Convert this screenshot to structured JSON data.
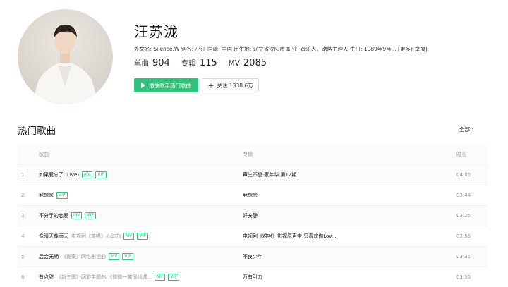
{
  "artist": {
    "name": "汪苏泷",
    "meta": {
      "en_label": "外文名:",
      "en": "Silence.W",
      "alias_label": "别名:",
      "alias": "小汪",
      "nation_label": "国籍:",
      "nation": "中国",
      "birthplace_label": "出生地:",
      "birthplace": "辽宁省沈阳市",
      "job_label": "职业:",
      "job": "音乐人、潮牌主理人",
      "birthday_label": "生日:",
      "birthday": "1989年9月l...",
      "more": "[更多]",
      "report": "[举报]"
    },
    "counts": {
      "songs_label": "单曲",
      "songs": "904",
      "albums_label": "专辑",
      "albums": "115",
      "mv_label": "MV",
      "mv": "2085"
    },
    "play_button": "播放歌手热门歌曲",
    "follow_button": "关注 1338.6万"
  },
  "section": {
    "title": "热门歌曲",
    "all": "全部 ›"
  },
  "table": {
    "headers": {
      "song": "歌曲",
      "album": "专辑",
      "duration": "时长"
    },
    "rows": [
      {
        "idx": "1",
        "title": "如果爱忘了 (Live)",
        "sub": "",
        "tags": [
          "MV",
          "VIP"
        ],
        "album": "声生不息·家年华 第12期",
        "duration": "04:05"
      },
      {
        "idx": "2",
        "title": "我想念",
        "sub": "",
        "tags": [
          "VIP"
        ],
        "album": "我想念",
        "duration": "03:44"
      },
      {
        "idx": "3",
        "title": "不分手的恋爱",
        "sub": "",
        "tags": [
          "MV",
          "VIP"
        ],
        "album": "好安静",
        "duration": "03:25"
      },
      {
        "idx": "4",
        "title": "像晴天像雨天",
        "sub": "电视剧《难哄》心动曲",
        "tags": [
          "MV",
          "VIP"
        ],
        "album": "电视剧《难哄》影视原声带 只喜欢你Lov...",
        "duration": "03:56"
      },
      {
        "idx": "5",
        "title": "后会无期",
        "sub": "《诡案》网络剧插曲",
        "tags": [
          "MV",
          "VIP"
        ],
        "album": "不良少年",
        "duration": "03:31"
      },
      {
        "idx": "6",
        "title": "有点甜",
        "sub": "《新三国》网游主题曲/《微微一笑很倾城...",
        "tags": [
          "MV",
          "VIP"
        ],
        "album": "万有引力",
        "duration": "03:55"
      }
    ]
  },
  "colors": {
    "accent": "#31c27c"
  }
}
